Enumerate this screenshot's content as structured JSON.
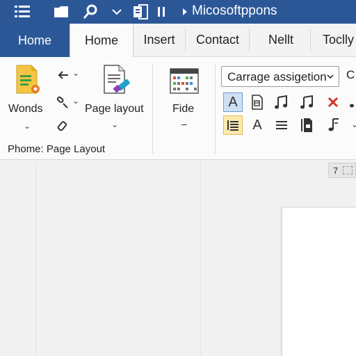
{
  "titlebar": {
    "title": "Micosoftppons",
    "icons": [
      "menu-list-icon",
      "folder-icon",
      "search-icon",
      "chevron-down-icon",
      "word-doc-icon",
      "pause-icon",
      "caret-right-icon"
    ]
  },
  "tabs": [
    {
      "label": "Home"
    },
    {
      "label": "Home"
    },
    {
      "label": "Insert"
    },
    {
      "label": "Contact"
    },
    {
      "label": "Nellt"
    },
    {
      "label": "Toclly"
    }
  ],
  "ribbon": {
    "wonds_label": "Wonds",
    "page_layout_label": "Page layout",
    "fide_label": "Fide",
    "fide_sub": "–",
    "group_label": "Phome: Page Layout",
    "style_dropdown_value": "Carrage assigetion",
    "cutoff_letter": "C",
    "font_letter_a": "A",
    "font_letter_a2": "A"
  },
  "ruler": {
    "value": "7"
  },
  "colors": {
    "title_blue": "#2b5797",
    "ribbon_bg": "#fbfbfb",
    "close_red": "#d32f2f",
    "highlight_blue": "#cfe0f5",
    "highlight_yellow": "#fdeab0"
  }
}
